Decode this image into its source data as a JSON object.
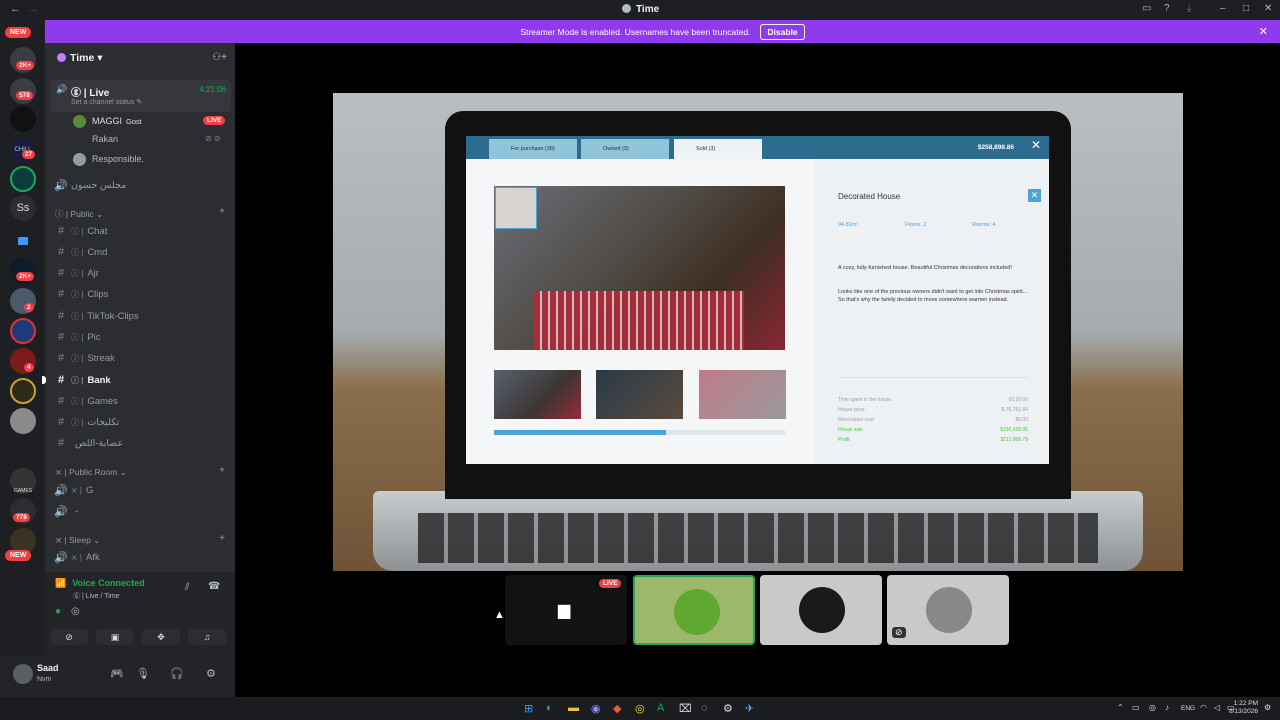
{
  "titlebar": {
    "title": "Time",
    "back": "←",
    "forward": "→"
  },
  "streamer": {
    "message": "Streamer Mode is enabled. Usernames have been truncated.",
    "disable_label": "Disable",
    "close": "✕"
  },
  "servers": {
    "badges": [
      "NEW",
      "2K+",
      "578",
      "27",
      "2K+",
      "2",
      "4",
      "778",
      "NEW"
    ],
    "text_icon": "Ss",
    "chill_label": "CHILL",
    "games_label": "GAMES"
  },
  "guild": {
    "name": "Time ▾"
  },
  "voice_live": {
    "name": "ⓖ | Live",
    "timer": "4:21:06",
    "status": "Set a channel status ✎"
  },
  "members": [
    {
      "name": "MAGGI",
      "tag": "Gost",
      "live": "LIVE"
    },
    {
      "name": "Rakan"
    },
    {
      "name": "Responsible."
    }
  ],
  "voice_channel_2": {
    "name": "مجلس حسون"
  },
  "categories": {
    "public": "ⓘ | Public ⌄",
    "public_room": "⨯ | Public Room ⌄",
    "sleep": "⨯ | Sleep ⌄"
  },
  "channels": [
    {
      "name": "Chat",
      "prefix": "ⓘ |"
    },
    {
      "name": "Cmd",
      "prefix": "ⓘ |"
    },
    {
      "name": "Ajr",
      "prefix": "ⓘ |"
    },
    {
      "name": "Clips",
      "prefix": "ⓘ |"
    },
    {
      "name": "TikTok-Clips",
      "prefix": "ⓘ |"
    },
    {
      "name": "Pic",
      "prefix": "ⓘ |"
    },
    {
      "name": "Streak",
      "prefix": "ⓘ |"
    },
    {
      "name": "Bank",
      "prefix": "ⓘ |"
    },
    {
      "name": "Games",
      "prefix": "ⓘ |"
    },
    {
      "name": "تكليجات",
      "prefix": "ⓘ |"
    },
    {
      "name": "عصابة-اللص",
      "prefix": ""
    }
  ],
  "voice_channels": [
    {
      "name": "G",
      "prefix": "⨯ |"
    },
    {
      "name": "-",
      "prefix": ""
    },
    {
      "name": "Afk",
      "prefix": "⨯ |"
    }
  ],
  "voice_panel": {
    "status": "Voice Connected",
    "sub": "ⓖ | Live / Time"
  },
  "user": {
    "name": "Saad",
    "status": "Nvm"
  },
  "game": {
    "tabs": [
      "For purchase (38)",
      "Owned (3)",
      "Sold (3)"
    ],
    "money": "$258,898.86",
    "house_title": "Decorated House",
    "stats": [
      "94.81m²",
      "Floors: 2",
      "Rooms: 4"
    ],
    "desc1": "A cozy, fully-furnished house. Beautiful Christmas decorations included!",
    "desc2": "Looks like one of the previous owners didn't want to get into Christmas spirit... So that's why the family decided to move somewhere warmer instead.",
    "financials": [
      {
        "label": "Time spent in the house",
        "value": "00:20:00",
        "color": "gray"
      },
      {
        "label": "House price",
        "value": "$-76,751.84",
        "color": "gray"
      },
      {
        "label": "Renovation cost",
        "value": "$0.00",
        "color": "gray"
      },
      {
        "label": "House sale",
        "value": "$190,628.95",
        "color": "green"
      },
      {
        "label": "Profit",
        "value": "$113,808.79",
        "color": "green"
      }
    ],
    "progress": 0.59
  },
  "tiles": {
    "live_label": "LIVE"
  },
  "taskbar": {
    "lang": "ENG",
    "time": "1:22 PM",
    "date": "8/13/2026"
  },
  "colors": {
    "accent": "#8f3aed",
    "green": "#23a55a",
    "red": "#f23f42",
    "game_blue": "#4ba3d8"
  }
}
